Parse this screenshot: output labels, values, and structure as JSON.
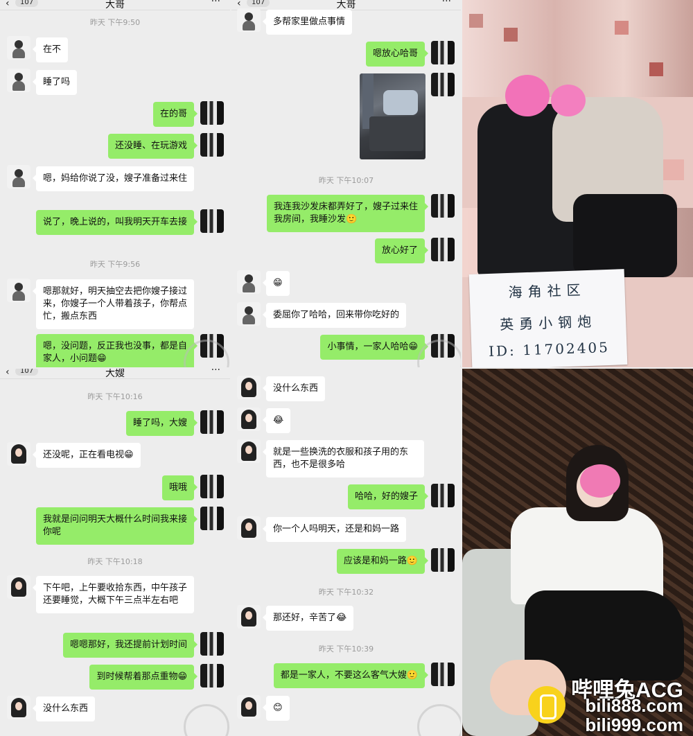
{
  "tl": {
    "header": {
      "back": "‹",
      "count": "107",
      "title": "大哥",
      "more": "···"
    },
    "timestamps": [
      "昨天 下午9:50",
      "昨天 下午9:56"
    ],
    "messages": [
      "在不",
      "睡了吗",
      "在的哥",
      "还没睡、在玩游戏",
      "嗯，妈给你说了没，嫂子准备过来住",
      "说了，晚上说的，叫我明天开车去接",
      "嗯那就好，明天抽空去把你嫂子接过来，你嫂子一个人带着孩子，你帮点忙，搬点东西",
      "嗯，没问题，反正我也没事，都是自家人，小问题😁"
    ]
  },
  "tm": {
    "header": {
      "back": "‹",
      "count": "107",
      "title": "大哥",
      "more": "···"
    },
    "timestamps": [
      "昨天 下午10:07"
    ],
    "messages": [
      "多帮家里做点事情",
      "嗯放心哈哥",
      "我连我沙发床都弄好了，嫂子过来住我房间，我睡沙发🙂",
      "放心好了",
      "😁",
      "委屈你了哈哈，回来带你吃好的",
      "小事情，一家人哈哈😁"
    ]
  },
  "bl": {
    "header": {
      "back": "‹",
      "count": "107",
      "title": "大嫂",
      "more": "···"
    },
    "timestamps": [
      "昨天 下午10:16",
      "昨天 下午10:18"
    ],
    "messages": [
      "睡了吗，大嫂",
      "还没呢，正在看电视😁",
      "哦哦",
      "我就是问问明天大概什么时间我来接你呢",
      "下午吧，上午要收拾东西，中午孩子还要睡觉，大概下午三点半左右吧",
      "嗯嗯那好，我还提前计划时间",
      "到时候帮着那点重物😁",
      "没什么东西"
    ]
  },
  "bm": {
    "timestamps": [
      "昨天 下午10:32",
      "昨天 下午10:39"
    ],
    "messages": [
      "没什么东西",
      "😂",
      "就是一些换洗的衣服和孩子用的东西，也不是很多哈",
      "哈哈，好的嫂子",
      "你一个人吗明天，还是和妈一路",
      "应该是和妈一路🙂",
      "那还好，辛苦了😂",
      "都是一家人，不要这么客气大嫂🙂",
      "😊"
    ]
  },
  "photo_card": {
    "line1": "海角社区",
    "line2": "英勇小钢炮",
    "line3": "ID: 11702405"
  },
  "brand": {
    "name": "哔哩兔ACG",
    "url1": "bili888.com",
    "url2": "bili999.com"
  },
  "colors": {
    "incoming": "#ffffff",
    "outgoing": "#95ec69",
    "background": "#ededed"
  }
}
